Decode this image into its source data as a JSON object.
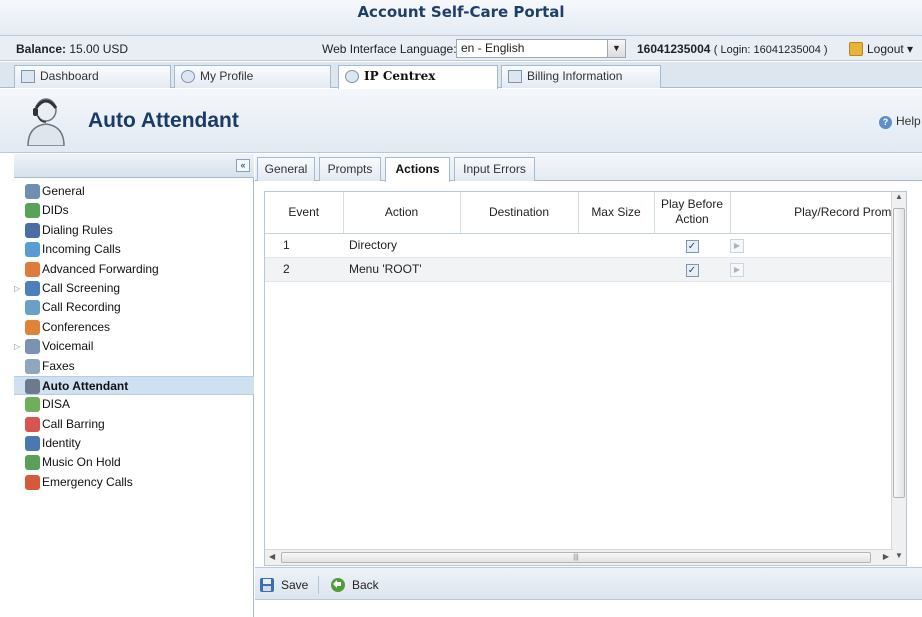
{
  "portal": {
    "title": "Account Self-Care Portal"
  },
  "status": {
    "balance_label": "Balance:",
    "balance_value": "15.00 USD",
    "language_label": "Web Interface Language:",
    "language_value": "en - English",
    "account_number": "16041235004",
    "login_text": "( Login: 16041235004 )",
    "logout_label": "Logout"
  },
  "main_tabs": [
    {
      "label": "Dashboard"
    },
    {
      "label": "My Profile"
    },
    {
      "label": "IP Centrex",
      "active": true
    },
    {
      "label": "Billing Information"
    }
  ],
  "header": {
    "title": "Auto Attendant",
    "help_label": "Help"
  },
  "sidebar": {
    "collapse_icon": "double-chevron-left",
    "items": [
      {
        "label": "General",
        "icon": "gear-icon",
        "color": "#6e8fb3"
      },
      {
        "label": "DIDs",
        "icon": "network-icon",
        "color": "#5aa15a"
      },
      {
        "label": "Dialing Rules",
        "icon": "calculator-icon",
        "color": "#4a6fa5"
      },
      {
        "label": "Incoming Calls",
        "icon": "incoming-call-icon",
        "color": "#5b9bd5"
      },
      {
        "label": "Advanced Forwarding",
        "icon": "forward-icon",
        "color": "#e07a3a"
      },
      {
        "label": "Call Screening",
        "icon": "screening-icon",
        "color": "#4c7fbd",
        "expandable": true
      },
      {
        "label": "Call Recording",
        "icon": "recording-icon",
        "color": "#6aa0c8"
      },
      {
        "label": "Conferences",
        "icon": "conference-icon",
        "color": "#e0833a"
      },
      {
        "label": "Voicemail",
        "icon": "voicemail-icon",
        "color": "#7a93b0",
        "expandable": true
      },
      {
        "label": "Faxes",
        "icon": "fax-icon",
        "color": "#8fa6bd"
      },
      {
        "label": "Auto Attendant",
        "icon": "attendant-icon",
        "color": "#6b7b8c",
        "active": true
      },
      {
        "label": "DISA",
        "icon": "disa-icon",
        "color": "#6fae5a"
      },
      {
        "label": "Call Barring",
        "icon": "barring-icon",
        "color": "#d9534f"
      },
      {
        "label": "Identity",
        "icon": "identity-icon",
        "color": "#4a78b0"
      },
      {
        "label": "Music On Hold",
        "icon": "music-icon",
        "color": "#5aa05a"
      },
      {
        "label": "Emergency Calls",
        "icon": "emergency-icon",
        "color": "#d65a3a"
      }
    ]
  },
  "sub_tabs": [
    {
      "label": "General"
    },
    {
      "label": "Prompts"
    },
    {
      "label": "Actions",
      "active": true
    },
    {
      "label": "Input Errors"
    }
  ],
  "table": {
    "columns": [
      "Event",
      "Action",
      "Destination",
      "Max Size",
      "Play Before Action",
      "Play/Record Prompt"
    ],
    "rows": [
      {
        "event": "1",
        "action": "Directory",
        "destination": "",
        "max_size": "",
        "play_before": true
      },
      {
        "event": "2",
        "action": "Menu 'ROOT'",
        "destination": "",
        "max_size": "",
        "play_before": true
      }
    ]
  },
  "toolbar": {
    "save_label": "Save",
    "back_label": "Back"
  }
}
